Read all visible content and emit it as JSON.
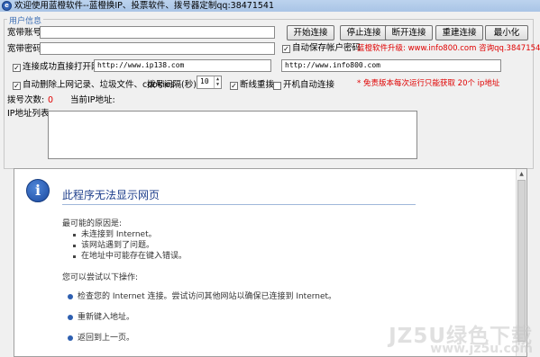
{
  "window": {
    "title": "欢迎使用蓝橙软件--蓝橙换IP、投票软件、拨号器定制qq:38471541"
  },
  "group": {
    "legend": "用户信息"
  },
  "account": {
    "label": "宽带账号:",
    "value": ""
  },
  "password": {
    "label": "宽带密码:",
    "value": ""
  },
  "buttons": {
    "connect": "开始连接",
    "stop": "停止连接",
    "disconnect": "断开连接",
    "reconnect": "重建连接",
    "minimize": "最小化"
  },
  "options": {
    "save_account": "自动保存帐户密码",
    "open_url": "连接成功直接打开网址",
    "clear_history": "自动删除上网记录、垃圾文件、cookies",
    "reconnect_on_drop": "断线重拨",
    "auto_connect_on_boot": "开机自动连接"
  },
  "upgrade_text": "蓝橙软件升级: www.info800.com 咨询qq.38471541",
  "url_fields": {
    "url1": "http://www.ip138.com",
    "url2": "http://www.info800.com"
  },
  "dial_interval": {
    "label": "拨号间隔(秒):",
    "value": "10"
  },
  "free_notice": "* 免责版本每次运行只能获取 20个 ip地址",
  "status": {
    "dial_count_label": "拨号次数:",
    "dial_count": "0",
    "current_ip_label": "当前IP地址:"
  },
  "ip_list": {
    "label": "IP地址列表:"
  },
  "browser": {
    "title": "此程序无法显示网页",
    "causes_heading": "最可能的原因是:",
    "causes": [
      "未连接到 Internet。",
      "该网站遇到了问题。",
      "在地址中可能存在键入错误。"
    ],
    "try_heading": "您可以尝试以下操作:",
    "actions": [
      "检查您的 Internet 连接。尝试访问其他网站以确保已连接到 Internet。",
      "重新键入地址。",
      "返回到上一页。"
    ]
  },
  "watermark": {
    "line1": "JZ5U绿色下载",
    "line2": "www.jz5u.com"
  }
}
